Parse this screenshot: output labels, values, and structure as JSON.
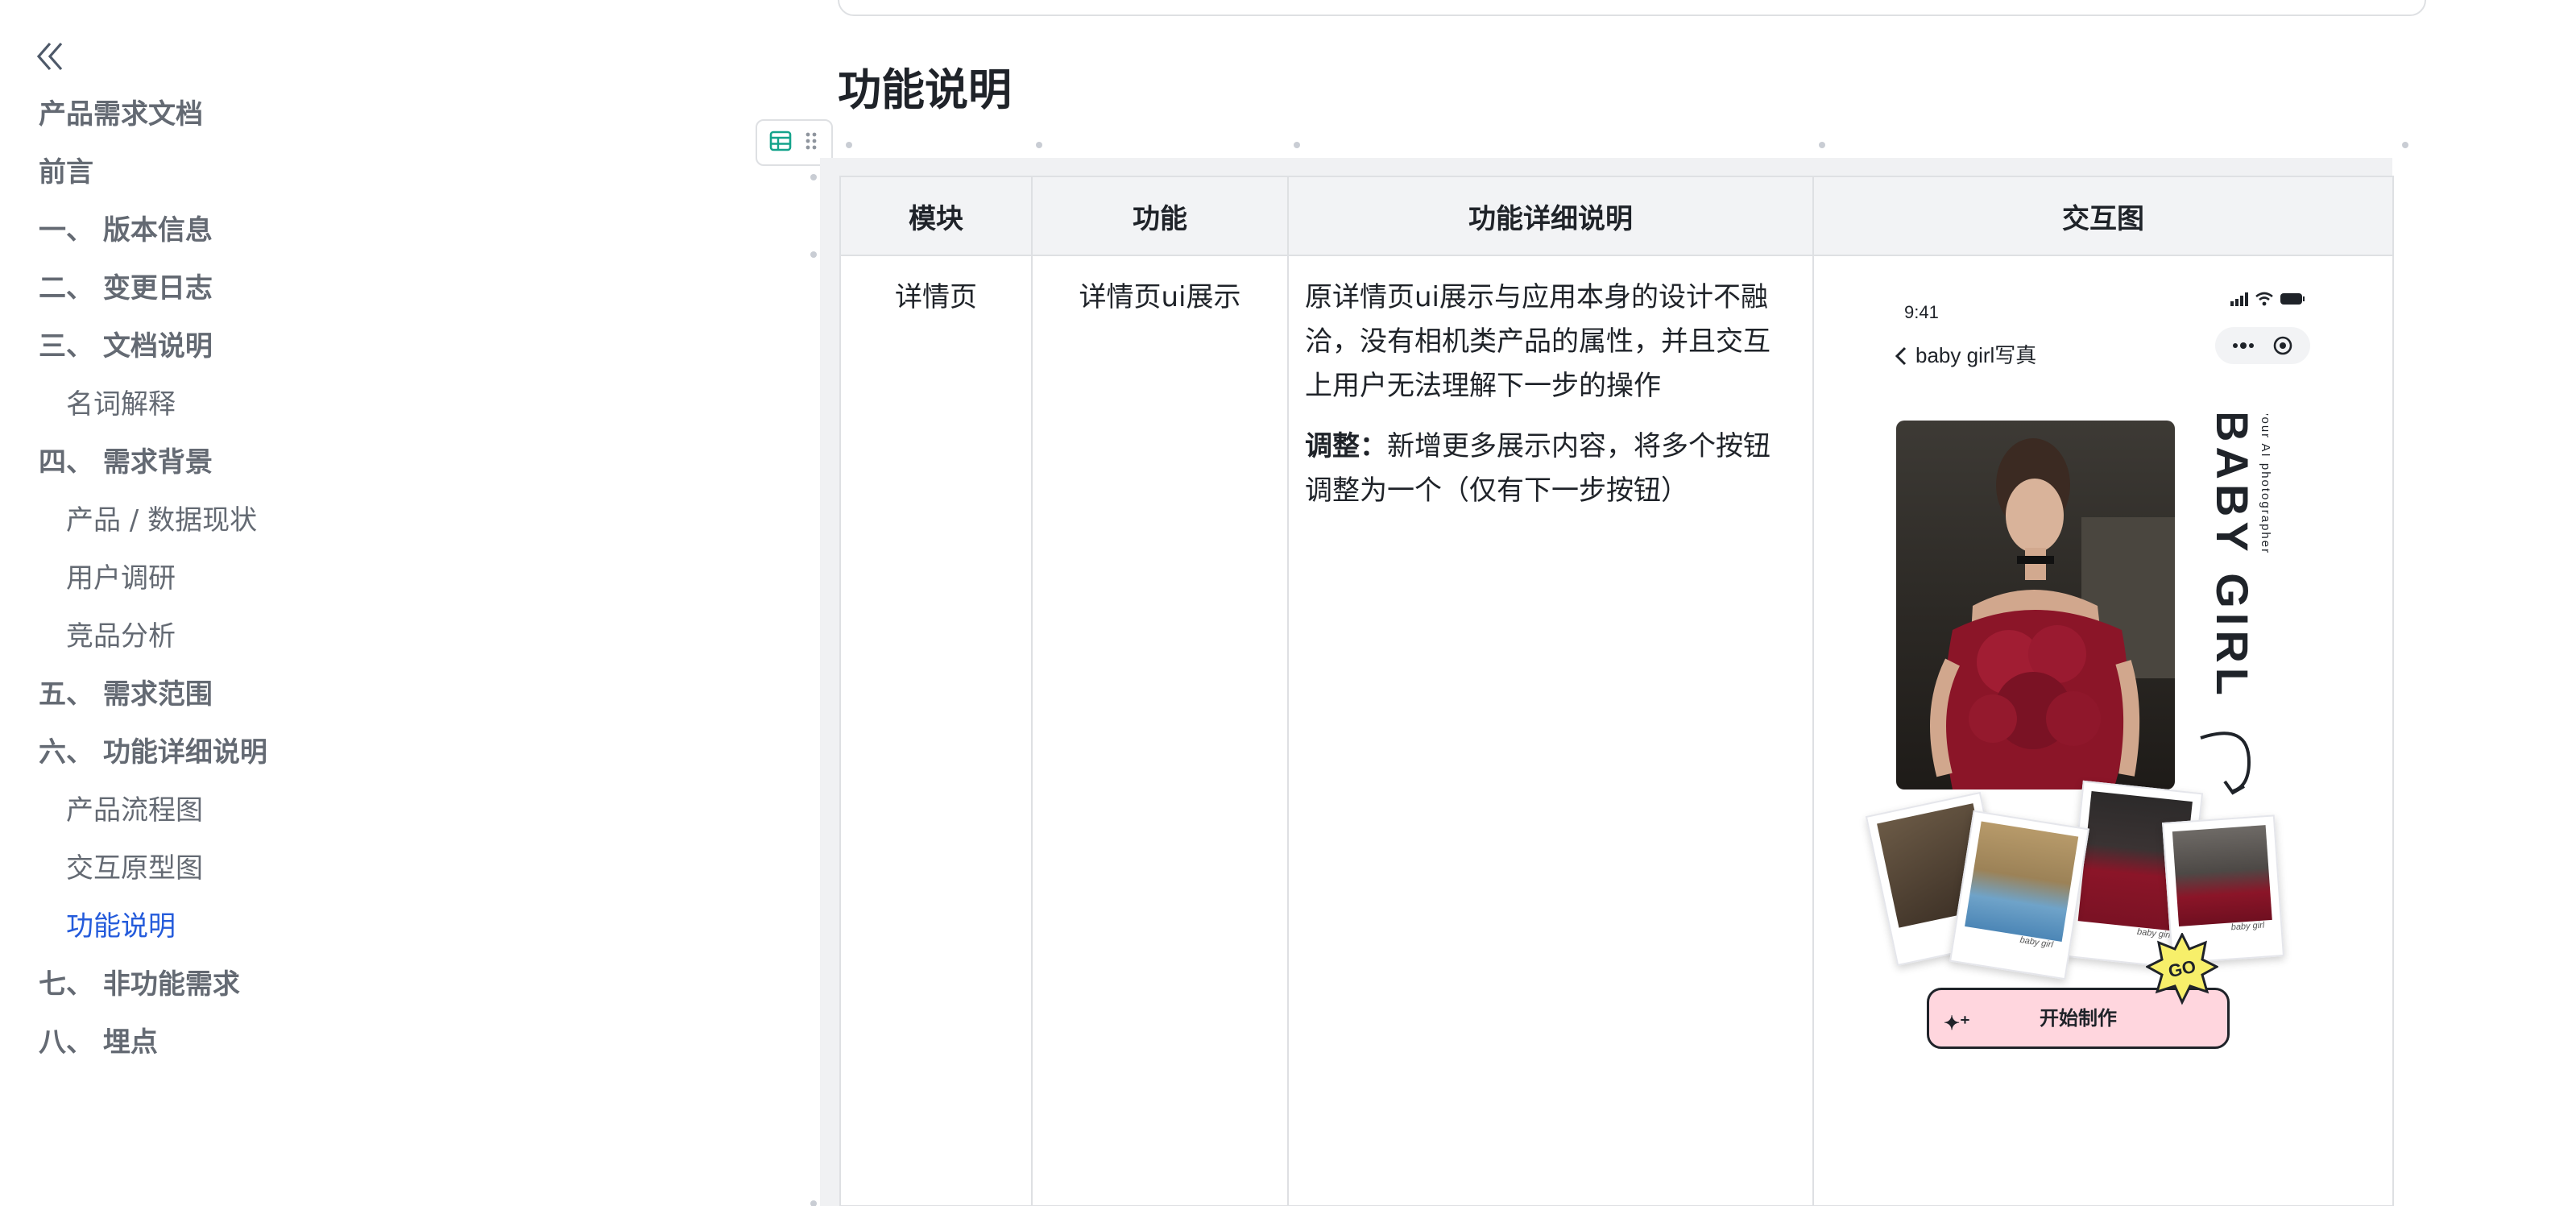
{
  "sidebar": {
    "items": [
      {
        "label": "产品需求文档",
        "level": 1
      },
      {
        "label": "前言",
        "level": 1
      },
      {
        "label": "一、 版本信息",
        "level": 1
      },
      {
        "label": "二、 变更日志",
        "level": 1
      },
      {
        "label": "三、 文档说明",
        "level": 1
      },
      {
        "label": "名词解释",
        "level": 2
      },
      {
        "label": "四、 需求背景",
        "level": 1
      },
      {
        "label": "产品 / 数据现状",
        "level": 2
      },
      {
        "label": "用户调研",
        "level": 2
      },
      {
        "label": "竞品分析",
        "level": 2
      },
      {
        "label": "五、 需求范围",
        "level": 1
      },
      {
        "label": "六、 功能详细说明",
        "level": 1
      },
      {
        "label": "产品流程图",
        "level": 2
      },
      {
        "label": "交互原型图",
        "level": 2
      },
      {
        "label": "功能说明",
        "level": 2,
        "active": true
      },
      {
        "label": "七、 非功能需求",
        "level": 1
      },
      {
        "label": "八、 埋点",
        "level": 1
      }
    ],
    "active_color": "#245bdb"
  },
  "main": {
    "heading": "功能说明",
    "table": {
      "headers": [
        "模块",
        "功能",
        "功能详细说明",
        "交互图"
      ],
      "rows": [
        {
          "module": "详情页",
          "feature": "详情页ui展示",
          "desc_para1": "原详情页ui展示与应用本身的设计不融洽，没有相机类产品的属性，并且交互上用户无法理解下一步的操作",
          "desc_adjust_label": "调整：",
          "desc_adjust_text": "新增更多展示内容，将多个按钮调整为一个（仅有下一步按钮）"
        }
      ]
    }
  },
  "mockup": {
    "time": "9:41",
    "back_title": "baby girl写真",
    "brand_title": "BABY GIRL",
    "brand_subtitle": "your AI photographer",
    "polaroid_caption": "baby girl",
    "go_badge": "GO",
    "start_button": "开始制作",
    "accent_pink": "#ffd6de",
    "badge_yellow": "#f7ef6a",
    "dress_red": "#8b1528"
  }
}
